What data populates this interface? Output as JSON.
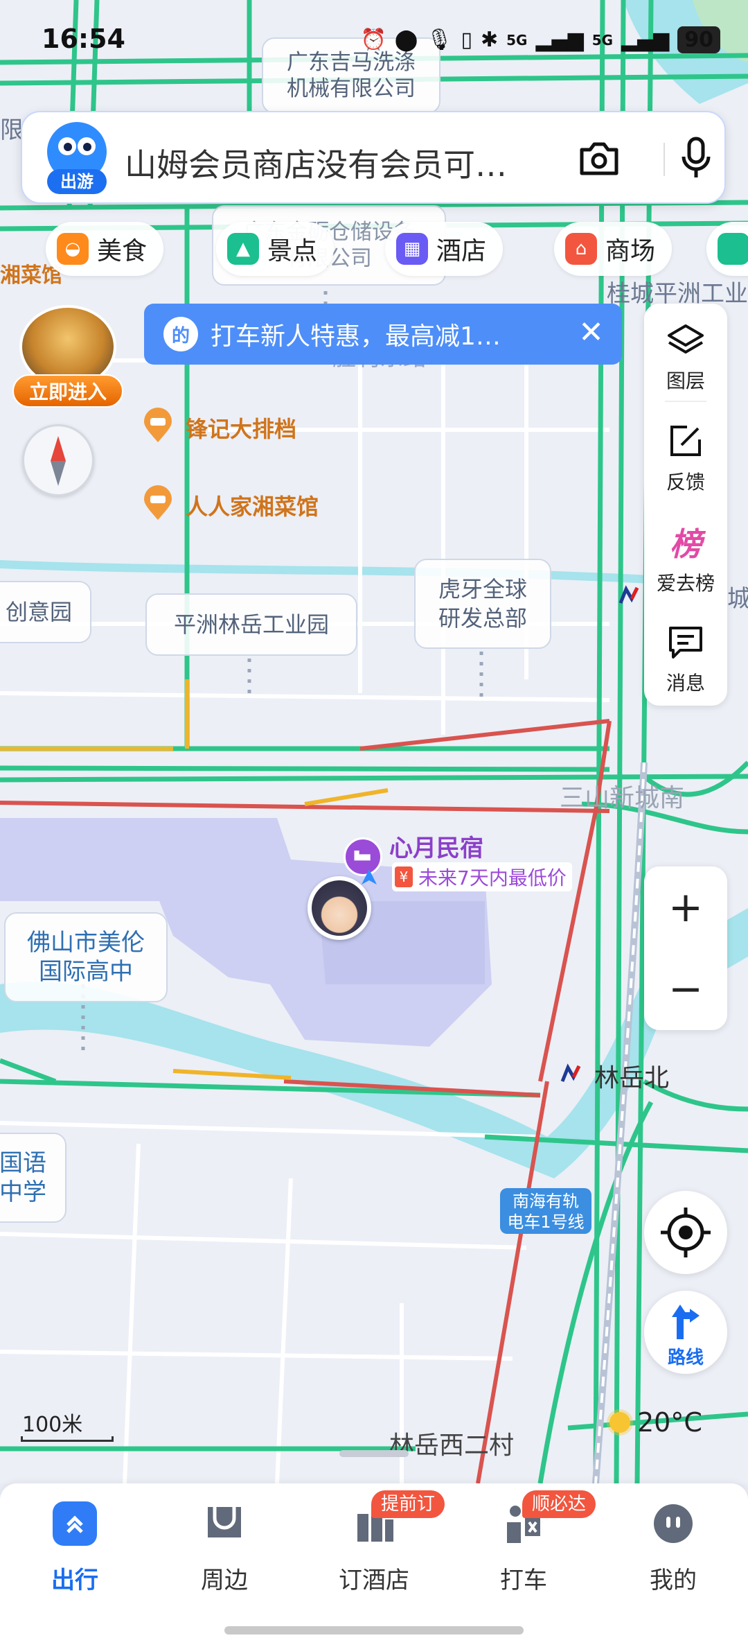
{
  "status_bar": {
    "time": "16:54",
    "network_1": "5G",
    "network_2": "5G",
    "battery": "90",
    "icons": [
      "alarm-icon",
      "location-icon",
      "mic-icon",
      "vibrate-icon",
      "bluetooth-icon",
      "signal-icon"
    ]
  },
  "search": {
    "mascot_tag": "出游",
    "query": "山姆会员商店没有会员可…",
    "camera_icon": "camera-icon",
    "voice_icon": "mic-icon"
  },
  "categories": [
    {
      "label": "美食",
      "icon": "food-icon",
      "color": "#ff8a1c"
    },
    {
      "label": "景点",
      "icon": "scenic-icon",
      "color": "#1cbf8f"
    },
    {
      "label": "酒店",
      "icon": "hotel-icon",
      "color": "#6a5bf5"
    },
    {
      "label": "商场",
      "icon": "mall-icon",
      "color": "#f2563f"
    }
  ],
  "promo": {
    "logo": "的",
    "text": "打车新人特惠，最高减1…",
    "close": "✕"
  },
  "game_entry": {
    "button": "立即进入"
  },
  "tools": [
    {
      "label": "图层",
      "icon": "layers-icon"
    },
    {
      "label": "反馈",
      "icon": "feedback-icon"
    },
    {
      "label": "爱去榜",
      "icon": "ranking-icon",
      "glyph": "榜"
    },
    {
      "label": "消息",
      "icon": "message-icon"
    }
  ],
  "map": {
    "top_label_1": "广东吉马洗涤",
    "top_label_2": "机械有限公司",
    "label_left_edge": "限",
    "label_warehouse_1": "广东金砺仓储设备",
    "label_warehouse_2": "有限公司",
    "label_street": "胜利东路",
    "label_xiangcai": "湘菜馆",
    "label_guicheng": "桂城平洲工业",
    "poi_fengji": "锋记大排档",
    "poi_renren": "人人家湘菜馆",
    "card_chuangyi": "创意园",
    "card_pingzhou": "平洲林岳工业园",
    "card_huya_1": "虎牙全球",
    "card_huya_2": "研发总部",
    "label_cheng": "城",
    "label_sanshan": "三山新城南",
    "hotel_name": "心月民宿",
    "hotel_tag": "未来7天内最低价",
    "card_meilun_1": "佛山市美伦",
    "card_meilun_2": "国际高中",
    "label_linyuebei": "林岳北",
    "card_guoyu_1": "国语",
    "card_guoyu_2": "中学",
    "tram_1": "南海有轨",
    "tram_2": "电车1号线",
    "label_linyuexi": "林岳西二村"
  },
  "zoom": {
    "plus": "+",
    "minus": "−"
  },
  "route": {
    "label": "路线"
  },
  "scale": {
    "label": "100米"
  },
  "weather": {
    "temp": "20°C"
  },
  "bottom_nav": [
    {
      "label": "出行",
      "icon": "travel-icon",
      "active": true
    },
    {
      "label": "周边",
      "icon": "nearby-icon"
    },
    {
      "label": "订酒店",
      "icon": "hotel-book-icon",
      "badge": "提前订"
    },
    {
      "label": "打车",
      "icon": "taxi-icon",
      "badge": "顺必达"
    },
    {
      "label": "我的",
      "icon": "profile-icon"
    }
  ],
  "colors": {
    "accent": "#1a6df0",
    "road_green": "#2ec58a",
    "road_red": "#d9534f",
    "water": "#a6e3ec",
    "campus": "#cdd0f2",
    "poi_orange": "#d0741b"
  }
}
